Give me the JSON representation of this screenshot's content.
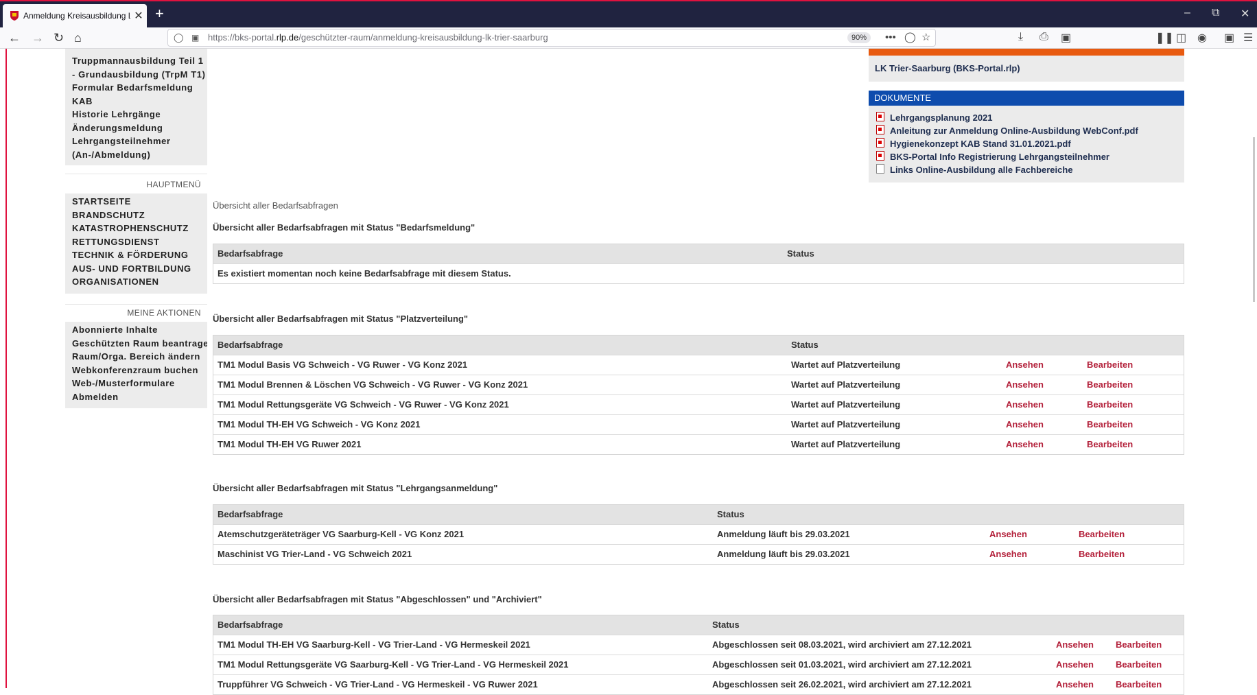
{
  "browser": {
    "tab_title": "Anmeldung Kreisausbildung LK",
    "tab_close": "✕",
    "new_tab": "+",
    "url_prefix": "https://bks-portal.",
    "url_domain": "rlp.de",
    "url_path": "/geschützter-raum/anmeldung-kreisausbildung-lk-trier-saarburg",
    "zoom": "90%",
    "icons": [
      "back-icon",
      "forward-icon",
      "reload-icon",
      "home-icon",
      "shield-icon",
      "lock-icon",
      "more-icon",
      "pocket-icon",
      "star-icon",
      "downloads-icon",
      "print-icon",
      "screenshot-icon",
      "library-icon",
      "sidebar-icon",
      "account-icon",
      "extensions-icon",
      "menu-icon"
    ]
  },
  "sidebar": {
    "top_items": [
      "Truppmannausbildung Teil 1",
      "- Grundausbildung (TrpM T1)",
      "Formular Bedarfsmeldung",
      "KAB",
      "Historie Lehrgänge",
      "Änderungsmeldung",
      "Lehrgangsteilnehmer",
      "(An-/Abmeldung)"
    ],
    "hauptmenu_title": "HAUPTMENÜ",
    "hauptmenu": [
      "STARTSEITE",
      "BRANDSCHUTZ",
      "KATASTROPHENSCHUTZ",
      "RETTUNGSDIENST",
      "TECHNIK & FÖRDERUNG",
      "AUS- UND FORTBILDUNG",
      "ORGANISATIONEN"
    ],
    "aktionen_title": "MEINE AKTIONEN",
    "aktionen": [
      "Abonnierte Inhalte",
      "Geschützten Raum beantragen",
      "Raum/Orga. Bereich ändern",
      "Webkonferenzraum buchen",
      "Web-/Musterformulare",
      "Abmelden"
    ]
  },
  "right": {
    "link_text": "LK Trier-Saarburg (BKS-Portal.rlp)",
    "documents_title": "DOKUMENTE",
    "documents": [
      {
        "label": "Lehrgangsplanung 2021",
        "icon": "pdf-icon"
      },
      {
        "label": "Anleitung zur Anmeldung Online-Ausbildung WebConf.pdf",
        "icon": "pdf-icon"
      },
      {
        "label": "Hygienekonzept KAB Stand 31.01.2021.pdf",
        "icon": "pdf-icon"
      },
      {
        "label": "BKS-Portal Info Registrierung Lehrgangsteilnehmer",
        "icon": "pdf-icon"
      },
      {
        "label": "Links Online-Ausbildung alle Fachbereiche",
        "icon": "document-icon"
      }
    ]
  },
  "main": {
    "title": "Übersicht aller Bedarfsabfragen",
    "col_request": "Bedarfsabfrage",
    "col_status": "Status",
    "view": "Ansehen",
    "edit": "Bearbeiten",
    "sec1": {
      "title": "Übersicht aller Bedarfsabfragen mit Status \"Bedarfsmeldung\"",
      "empty": "Es existiert momentan noch keine Bedarfsabfrage mit diesem Status."
    },
    "sec2": {
      "title": "Übersicht aller Bedarfsabfragen mit Status \"Platzverteilung\"",
      "rows": [
        {
          "name": "TM1 Modul Basis VG Schweich - VG Ruwer - VG Konz 2021",
          "status": "Wartet auf Platzverteilung"
        },
        {
          "name": "TM1 Modul Brennen & Löschen VG Schweich - VG Ruwer - VG Konz 2021",
          "status": "Wartet auf Platzverteilung"
        },
        {
          "name": "TM1 Modul Rettungsgeräte VG Schweich - VG Ruwer - VG Konz 2021",
          "status": "Wartet auf Platzverteilung"
        },
        {
          "name": "TM1 Modul TH-EH VG Schweich - VG Konz 2021",
          "status": "Wartet auf Platzverteilung"
        },
        {
          "name": "TM1 Modul TH-EH VG Ruwer 2021",
          "status": "Wartet auf Platzverteilung"
        }
      ]
    },
    "sec3": {
      "title": "Übersicht aller Bedarfsabfragen mit Status \"Lehrgangsanmeldung\"",
      "rows": [
        {
          "name": "Atemschutzgeräteträger VG Saarburg-Kell - VG Konz 2021",
          "status": "Anmeldung läuft bis 29.03.2021"
        },
        {
          "name": "Maschinist VG Trier-Land - VG Schweich 2021",
          "status": "Anmeldung läuft bis 29.03.2021"
        }
      ]
    },
    "sec4": {
      "title": "Übersicht aller Bedarfsabfragen mit Status \"Abgeschlossen\" und \"Archiviert\"",
      "rows": [
        {
          "name": "TM1 Modul TH-EH VG Saarburg-Kell - VG Trier-Land - VG Hermeskeil 2021",
          "status": "Abgeschlossen seit 08.03.2021, wird archiviert am 27.12.2021"
        },
        {
          "name": "TM1 Modul Rettungsgeräte VG Saarburg-Kell - VG Trier-Land - VG Hermeskeil 2021",
          "status": "Abgeschlossen seit 01.03.2021, wird archiviert am 27.12.2021"
        },
        {
          "name": "Truppführer VG Schweich - VG Trier-Land - VG Hermeskeil - VG Ruwer 2021",
          "status": "Abgeschlossen seit 26.02.2021, wird archiviert am 27.12.2021"
        }
      ]
    }
  }
}
